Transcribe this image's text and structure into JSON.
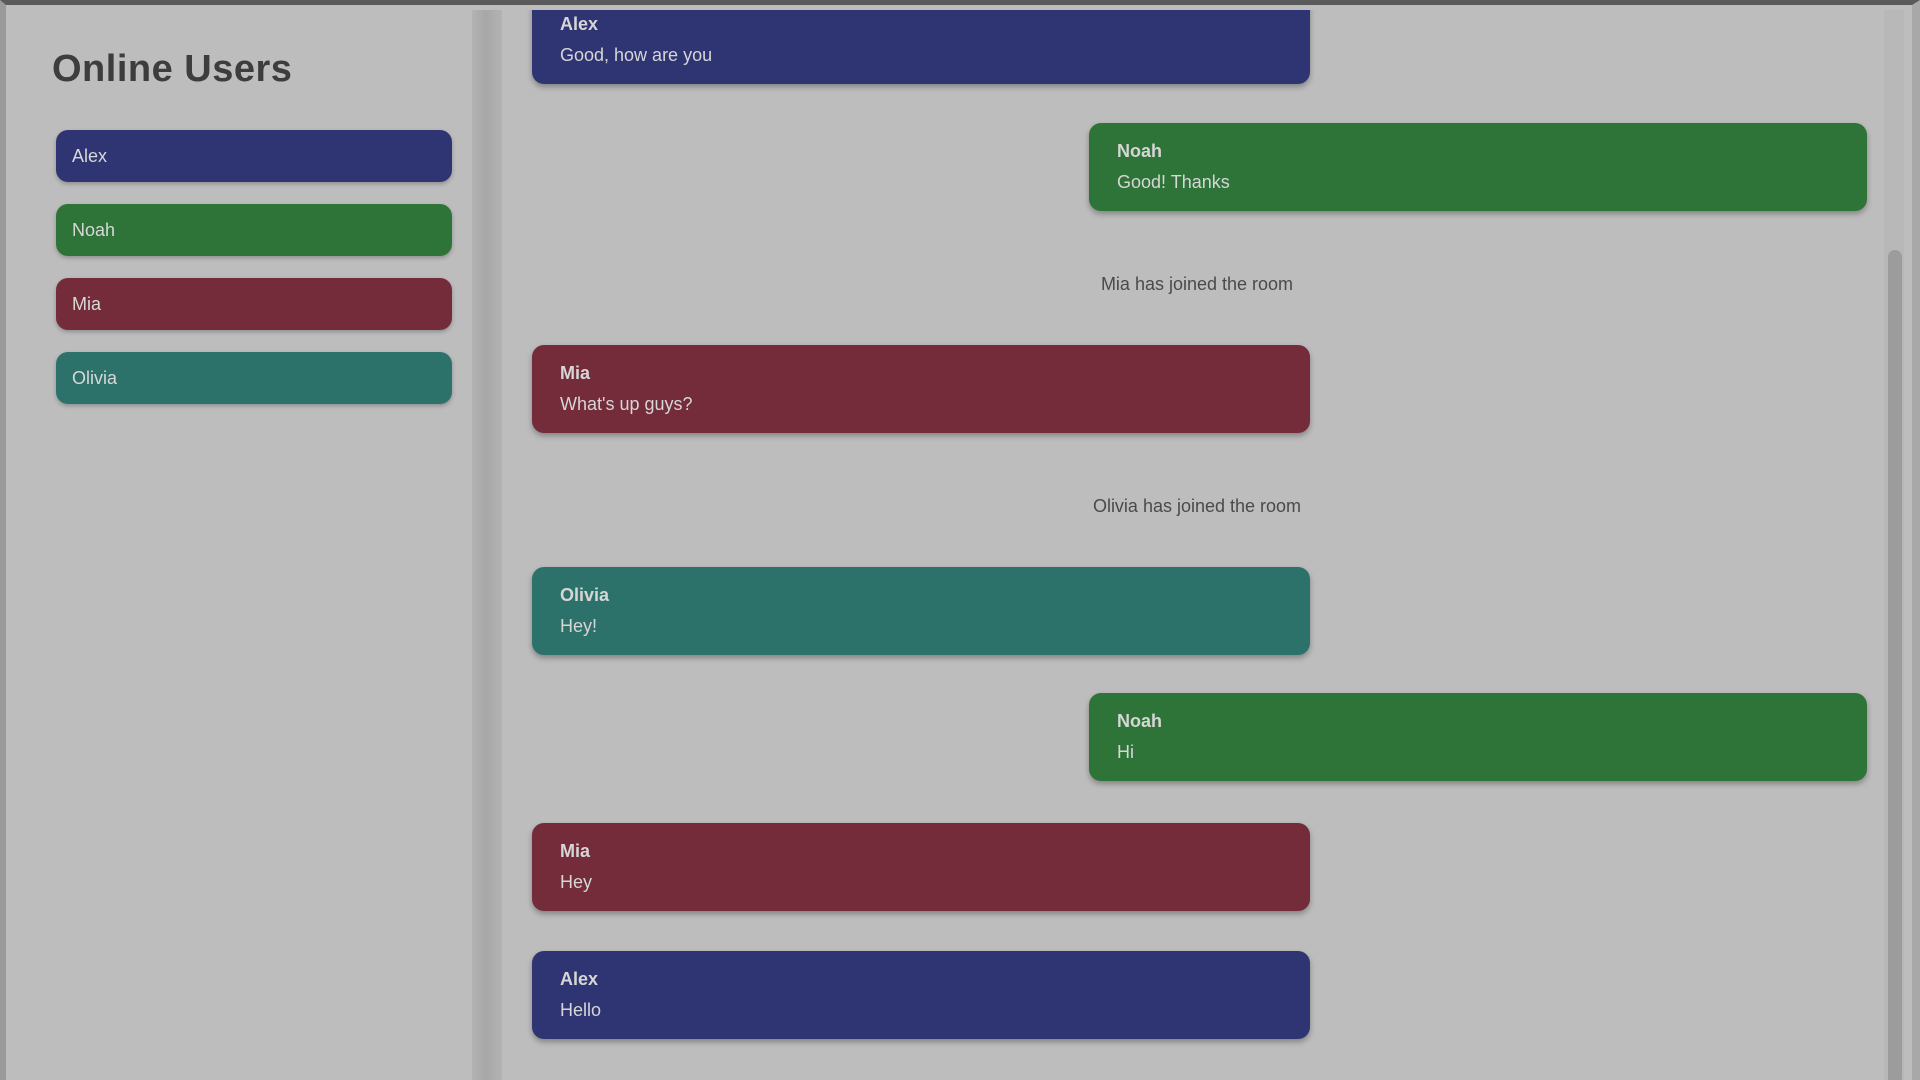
{
  "colors": {
    "blue": "#2f3573",
    "green": "#2e7337",
    "red": "#742b3a",
    "teal": "#2d716b"
  },
  "sidebar": {
    "title": "Online Users",
    "users": [
      {
        "name": "Alex",
        "color": "#2f3573"
      },
      {
        "name": "Noah",
        "color": "#2e7337"
      },
      {
        "name": "Mia",
        "color": "#742b3a"
      },
      {
        "name": "Olivia",
        "color": "#2d716b"
      }
    ]
  },
  "chat": {
    "messages": [
      {
        "kind": "message",
        "side": "left",
        "sender": "Alex",
        "text": "Good, how are you",
        "color": "#2f3573"
      },
      {
        "kind": "message",
        "side": "right",
        "sender": "Noah",
        "text": "Good! Thanks",
        "color": "#2e7337"
      },
      {
        "kind": "system",
        "text": "Mia has joined the room"
      },
      {
        "kind": "message",
        "side": "left",
        "sender": "Mia",
        "text": "What's up guys?",
        "color": "#742b3a"
      },
      {
        "kind": "system",
        "text": "Olivia has joined the room"
      },
      {
        "kind": "message",
        "side": "left",
        "sender": "Olivia",
        "text": "Hey!",
        "color": "#2d716b"
      },
      {
        "kind": "message",
        "side": "right",
        "sender": "Noah",
        "text": "Hi",
        "color": "#2e7337"
      },
      {
        "kind": "message",
        "side": "left",
        "sender": "Mia",
        "text": "Hey",
        "color": "#742b3a"
      },
      {
        "kind": "message",
        "side": "left",
        "sender": "Alex",
        "text": "Hello",
        "color": "#2f3573"
      }
    ]
  }
}
